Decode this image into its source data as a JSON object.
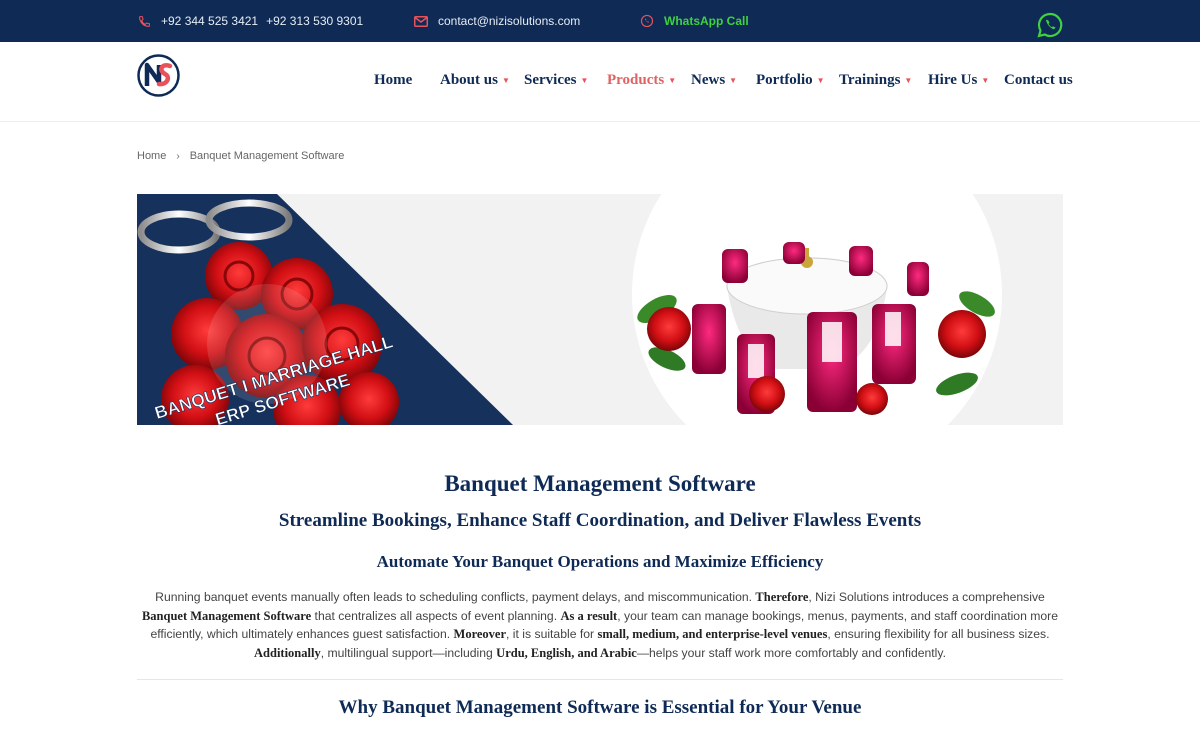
{
  "topbar": {
    "phone_icon": "phone-icon",
    "phone1": "+92 344 525 3421",
    "phone2": "+92 313 530 9301",
    "email_icon": "mail-icon",
    "email": "contact@nizisolutions.com",
    "whatsapp_icon": "whatsapp-icon",
    "whatsapp_label": "WhatsApp Call",
    "colors": {
      "background": "#0e2a55",
      "icon": "#e8525a",
      "whatsapp": "#3fd13f"
    }
  },
  "header": {
    "logo": "nizi-solutions-logo",
    "nav": [
      {
        "label": "Home",
        "caret": ""
      },
      {
        "label": "About us",
        "caret": "▼"
      },
      {
        "label": "Services",
        "caret": "▼"
      },
      {
        "label": "Products",
        "caret": "▼"
      },
      {
        "label": "News",
        "caret": "▼"
      },
      {
        "label": "Portfolio",
        "caret": "▼"
      },
      {
        "label": "Trainings",
        "caret": "▼"
      },
      {
        "label": "Hire Us",
        "caret": "▼"
      },
      {
        "label": "Contact us",
        "caret": ""
      }
    ],
    "active_item": "Products",
    "colors": {
      "nav": "#0e2a55",
      "active": "#e06363"
    }
  },
  "breadcrumb": {
    "home": "Home",
    "separator": "›",
    "current": "Banquet Management Software"
  },
  "banner": {
    "line1": "BANQUET I MARRIAGE HALL",
    "line2": "ERP SOFTWARE"
  },
  "content": {
    "title": "Banquet Management Software",
    "subtitle": "Streamline Bookings, Enhance Staff Coordination, and Deliver Flawless Events",
    "section_heading": "Automate Your Banquet Operations and Maximize Efficiency",
    "para": {
      "t1": "Running banquet events manually often leads to scheduling conflicts, payment delays, and miscommunication. ",
      "b1": "Therefore",
      "t2": ", Nizi Solutions introduces a comprehensive ",
      "b2": "Banquet Management Software",
      "t3": " that centralizes all aspects of event planning. ",
      "b3": "As a result",
      "t4": ", your team can manage bookings, menus, payments, and staff coordination more efficiently, which ultimately enhances guest satisfaction. ",
      "b4": "Moreover",
      "t5": ", it is suitable for ",
      "b5": "small, medium, and enterprise-level venues",
      "t6": ", ensuring flexibility for all business sizes. ",
      "b6": "Additionally",
      "t7": ", multilingual support—including ",
      "b7": "Urdu, English, and Arabic",
      "t8": "—helps your staff work more comfortably and confidently."
    },
    "why_heading": "Why Banquet Management Software is Essential for Your Venue"
  }
}
